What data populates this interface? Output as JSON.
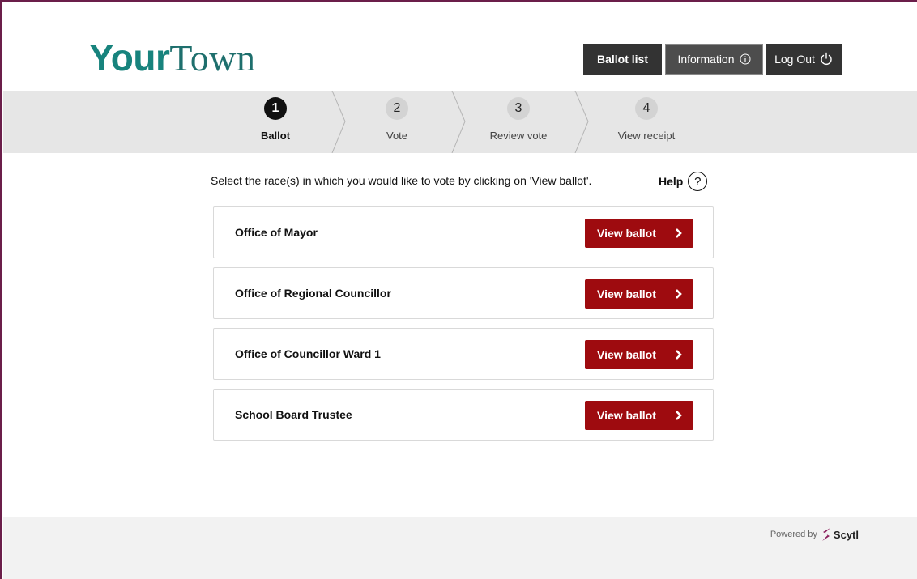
{
  "logo": {
    "part1": "Your",
    "part2": "Town"
  },
  "header": {
    "ballot_list": "Ballot list",
    "information": "Information",
    "logout": "Log Out"
  },
  "steps": [
    {
      "num": "1",
      "label": "Ballot"
    },
    {
      "num": "2",
      "label": "Vote"
    },
    {
      "num": "3",
      "label": "Review vote"
    },
    {
      "num": "4",
      "label": "View receipt"
    }
  ],
  "main": {
    "instruction": "Select the race(s) in which you would like to vote by clicking on 'View ballot'.",
    "help": "Help",
    "help_icon": "?"
  },
  "races": [
    {
      "name": "Office of Mayor",
      "button": "View ballot"
    },
    {
      "name": "Office of Regional Councillor",
      "button": "View ballot"
    },
    {
      "name": "Office of Councillor Ward 1",
      "button": "View ballot"
    },
    {
      "name": "School Board Trustee",
      "button": "View ballot"
    }
  ],
  "footer": {
    "powered_by": "Powered by",
    "brand": "Scytl"
  },
  "colors": {
    "accent": "#9e0b0f",
    "logo": "#17837d",
    "frame": "#6b1e4a",
    "dark_button": "#333333",
    "stepper_bg": "#e6e6e6"
  }
}
